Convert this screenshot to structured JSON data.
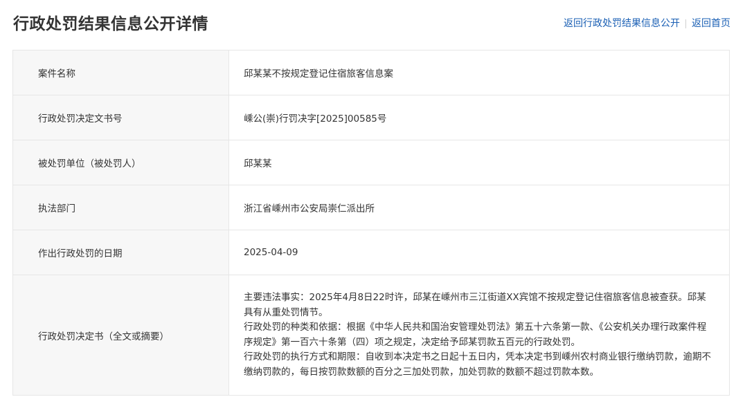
{
  "header": {
    "title": "行政处罚结果信息公开详情",
    "back_link": "返回行政处罚结果信息公开",
    "home_link": "返回首页"
  },
  "rows": [
    {
      "label": "案件名称",
      "value": "邱某某不按规定登记住宿旅客信息案"
    },
    {
      "label": "行政处罚决定文书号",
      "value": "嵊公(崇)行罚决字[2025]00585号"
    },
    {
      "label": "被处罚单位（被处罚人）",
      "value": "邱某某"
    },
    {
      "label": "执法部门",
      "value": "浙江省嵊州市公安局崇仁派出所"
    },
    {
      "label": "作出行政处罚的日期",
      "value": "2025-04-09"
    }
  ],
  "decision": {
    "label": "行政处罚决定书（全文或摘要）",
    "paragraphs": [
      "主要违法事实：2025年4月8日22时许，邱某在嵊州市三江街道XX宾馆不按规定登记住宿旅客信息被查获。邱某具有从重处罚情节。",
      "行政处罚的种类和依据：根据《中华人民共和国治安管理处罚法》第五十六条第一款、《公安机关办理行政案件程序规定》第一百六十条第（四）项之规定，决定给予邱某罚款五百元的行政处罚。",
      "行政处罚的执行方式和期限：自收到本决定书之日起十五日内，凭本决定书到嵊州农村商业银行缴纳罚款，逾期不缴纳罚款的，每日按罚款数额的百分之三加处罚款，加处罚款的数额不超过罚款本数。"
    ]
  },
  "colors": {
    "link": "#1a5fb4",
    "label_bg": "#f7f7f7",
    "border": "#e6e6e6",
    "text": "#333333"
  }
}
